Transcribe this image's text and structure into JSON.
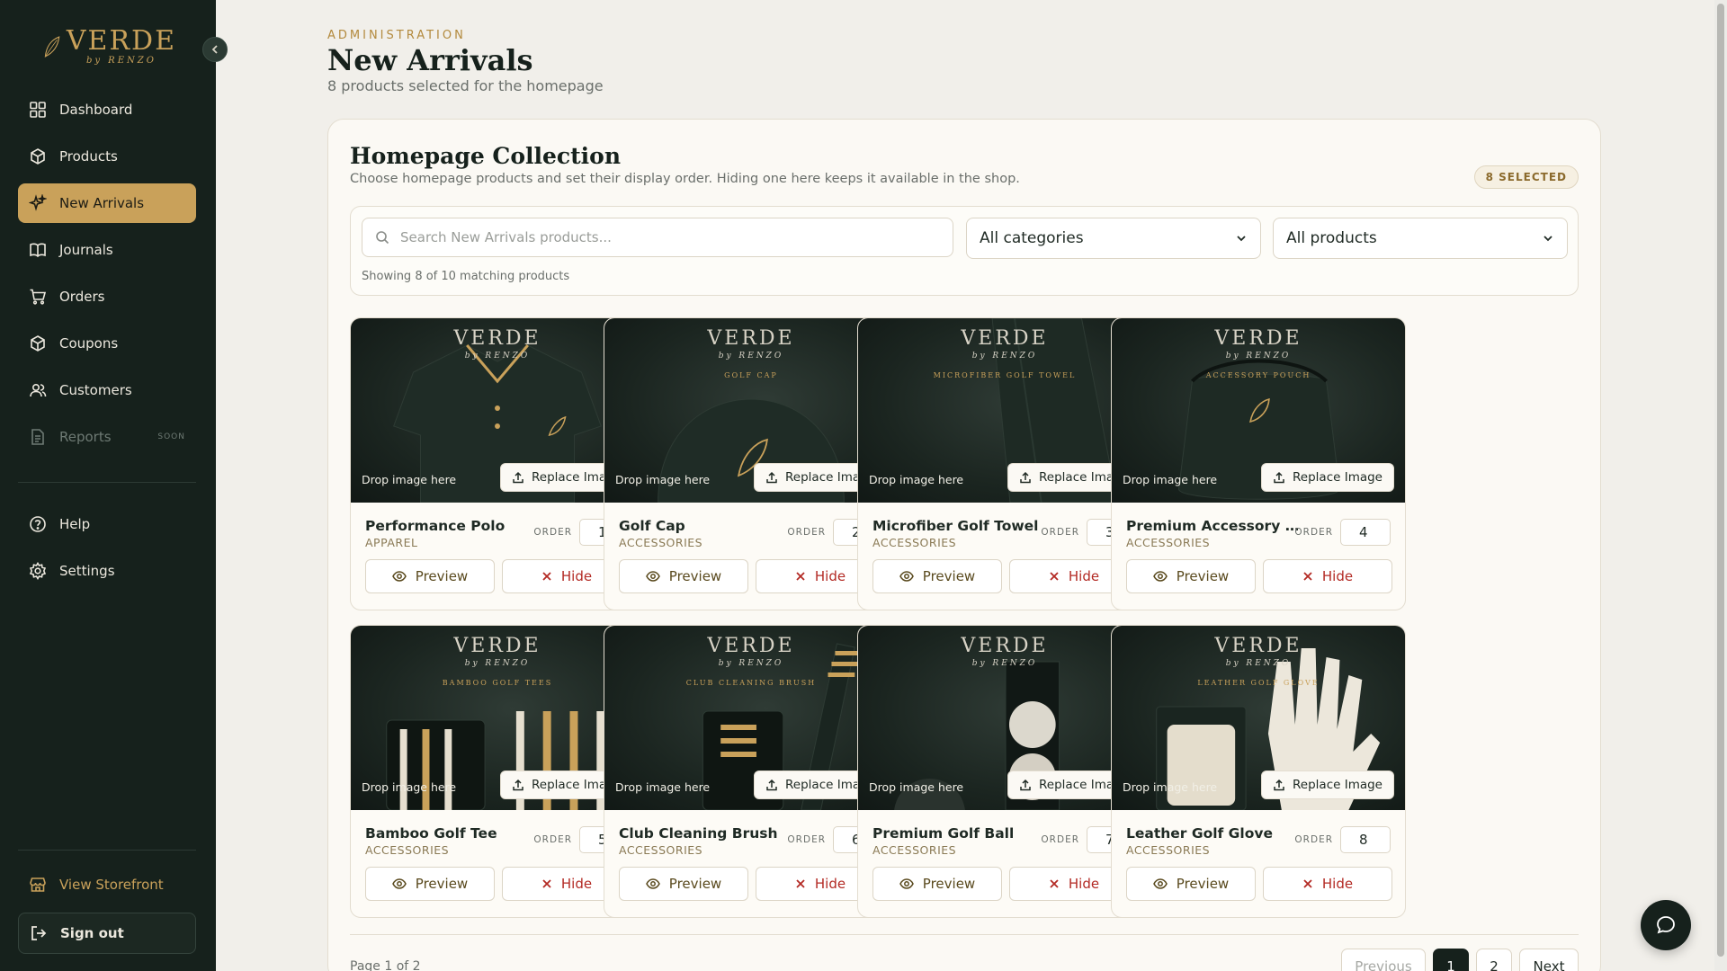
{
  "brand": {
    "name": "VERDE",
    "sub": "by RENZO"
  },
  "sidebar": {
    "items": [
      {
        "label": "Dashboard",
        "icon": "dashboard-icon"
      },
      {
        "label": "Products",
        "icon": "box-icon"
      },
      {
        "label": "New Arrivals",
        "icon": "sparkle-icon",
        "active": true
      },
      {
        "label": "Journals",
        "icon": "book-icon"
      },
      {
        "label": "Orders",
        "icon": "cart-icon"
      },
      {
        "label": "Coupons",
        "icon": "tag-icon"
      },
      {
        "label": "Customers",
        "icon": "users-icon"
      },
      {
        "label": "Reports",
        "icon": "report-icon",
        "badge": "SOON",
        "disabled": true
      }
    ],
    "secondary": [
      {
        "label": "Help",
        "icon": "help-icon"
      },
      {
        "label": "Settings",
        "icon": "gear-icon"
      }
    ],
    "storefront": "View Storefront",
    "signout": "Sign out"
  },
  "header": {
    "eyebrow": "ADMINISTRATION",
    "title": "New Arrivals",
    "subtitle": "8 products selected for the homepage"
  },
  "panel": {
    "title": "Homepage Collection",
    "subtitle": "Choose homepage products and set their display order. Hiding one here keeps it available in the shop.",
    "badge": "8 SELECTED",
    "search_placeholder": "Search New Arrivals products...",
    "category_select": "All categories",
    "product_select": "All products",
    "showing": "Showing 8 of 10 matching products"
  },
  "card_labels": {
    "drop": "Drop image here",
    "replace": "Replace Image",
    "order": "ORDER",
    "preview": "Preview",
    "hide": "Hide"
  },
  "products": [
    {
      "name": "Performance Polo",
      "category": "APPAREL",
      "order": "1",
      "art": "polo"
    },
    {
      "name": "Golf Cap",
      "category": "ACCESSORIES",
      "order": "2",
      "art": "cap",
      "print": "GOLF CAP"
    },
    {
      "name": "Microfiber Golf Towel",
      "category": "ACCESSORIES",
      "order": "3",
      "art": "towel",
      "print": "MICROFIBER GOLF TOWEL"
    },
    {
      "name": "Premium Accessory Po...",
      "category": "ACCESSORIES",
      "order": "4",
      "art": "pouch",
      "print": "ACCESSORY POUCH"
    },
    {
      "name": "Bamboo Golf Tee",
      "category": "ACCESSORIES",
      "order": "5",
      "art": "tees",
      "print": "BAMBOO GOLF TEES"
    },
    {
      "name": "Club Cleaning Brush",
      "category": "ACCESSORIES",
      "order": "6",
      "art": "brush",
      "print": "CLUB CLEANING BRUSH"
    },
    {
      "name": "Premium Golf Ball",
      "category": "ACCESSORIES",
      "order": "7",
      "art": "balls"
    },
    {
      "name": "Leather Golf Glove",
      "category": "ACCESSORIES",
      "order": "8",
      "art": "glove",
      "print": "LEATHER GOLF GLOVE"
    }
  ],
  "pagination": {
    "info": "Page 1 of 2",
    "previous": "Previous",
    "pages": [
      "1",
      "2"
    ],
    "current": "1",
    "next": "Next"
  },
  "colors": {
    "sidebar": "#16211c",
    "accent": "#c9a15a",
    "danger": "#b32a24",
    "background": "#f1efea"
  }
}
